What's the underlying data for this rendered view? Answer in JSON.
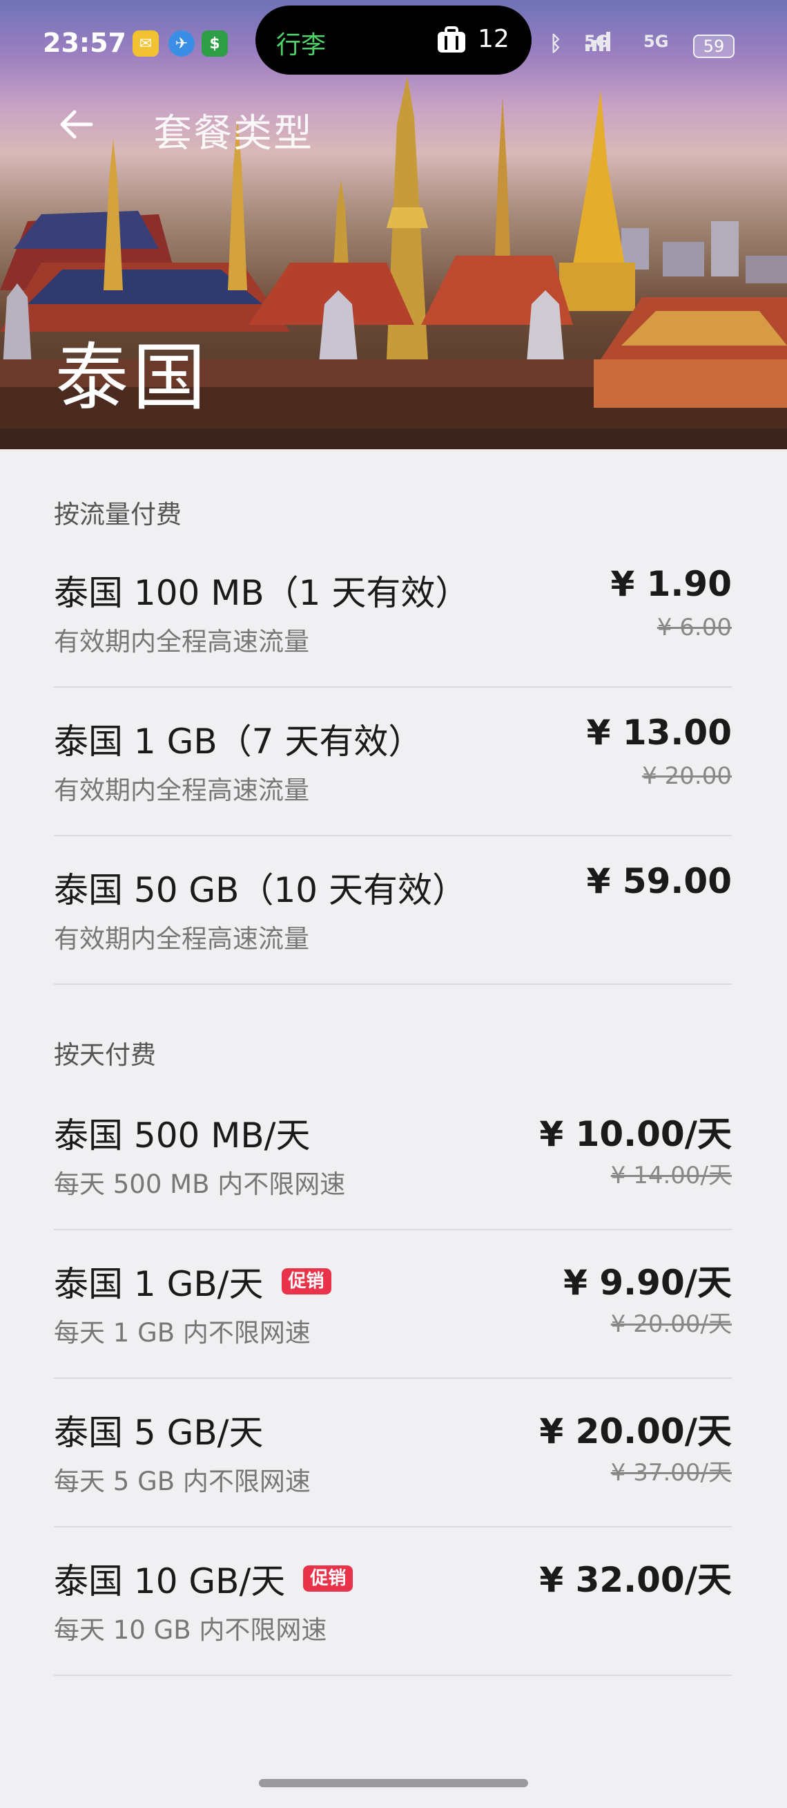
{
  "status_bar": {
    "time": "23:57",
    "island_label": "行李",
    "island_count": "12",
    "network_1": "5G",
    "network_2": "5G",
    "battery": "59"
  },
  "header": {
    "title": "套餐类型",
    "country": "泰国"
  },
  "sections": [
    {
      "title": "按流量付费",
      "items": [
        {
          "name": "泰国 100 MB（1 天有效）",
          "desc": "有效期内全程高速流量",
          "price": "¥ 1.90",
          "original_price": "¥ 6.00",
          "promo": ""
        },
        {
          "name": "泰国 1 GB（7 天有效）",
          "desc": "有效期内全程高速流量",
          "price": "¥ 13.00",
          "original_price": "¥ 20.00",
          "promo": ""
        },
        {
          "name": "泰国 50 GB（10 天有效）",
          "desc": "有效期内全程高速流量",
          "price": "¥ 59.00",
          "original_price": "",
          "promo": ""
        }
      ]
    },
    {
      "title": "按天付费",
      "items": [
        {
          "name": "泰国 500 MB/天",
          "desc": "每天 500 MB 内不限网速",
          "price": "¥ 10.00/天",
          "original_price": "¥ 14.00/天",
          "promo": ""
        },
        {
          "name": "泰国 1 GB/天",
          "desc": "每天 1 GB 内不限网速",
          "price": "¥ 9.90/天",
          "original_price": "¥ 20.00/天",
          "promo": "促销"
        },
        {
          "name": "泰国 5 GB/天",
          "desc": "每天 5 GB 内不限网速",
          "price": "¥ 20.00/天",
          "original_price": "¥ 37.00/天",
          "promo": ""
        },
        {
          "name": "泰国 10 GB/天",
          "desc": "每天 10 GB 内不限网速",
          "price": "¥ 32.00/天",
          "original_price": "",
          "promo": "促销"
        }
      ]
    }
  ],
  "colors": {
    "promo": "#e8334a",
    "background": "#f0f0f2",
    "island_text": "#4ed36b"
  },
  "icons": {
    "back": "arrow-left-icon",
    "luggage": "briefcase-icon"
  }
}
